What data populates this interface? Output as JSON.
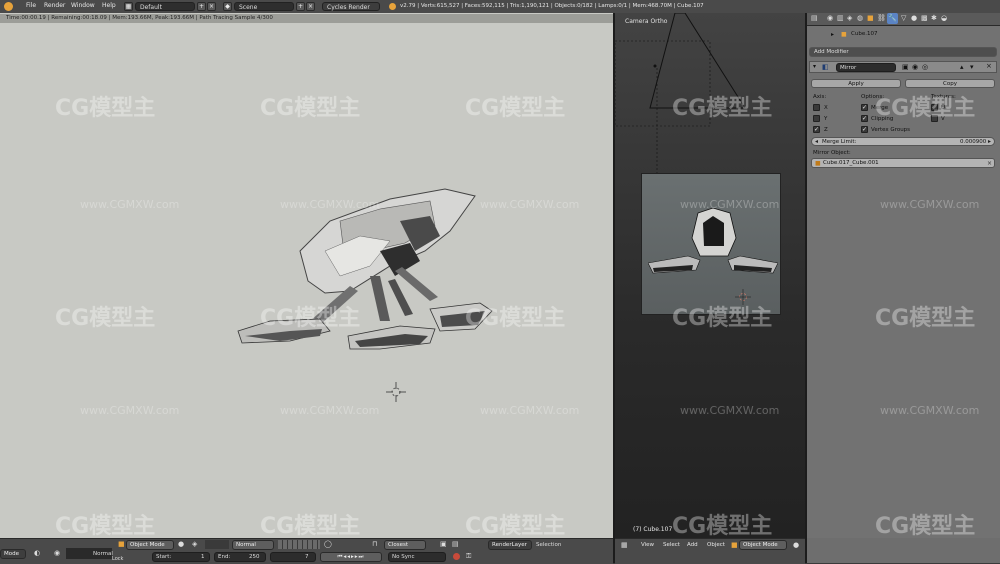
{
  "topbar": {
    "menus": [
      "File",
      "Render",
      "Window",
      "Help"
    ],
    "layout": "Default",
    "scene": "Scene",
    "engine": "Cycles Render",
    "stats": "v2.79 | Verts:615,527 | Faces:592,115 | Tris:1,190,121 | Objects:0/182 | Lamps:0/1 | Mem:468.70M | Cube.107"
  },
  "render_view": {
    "info": "Time:00:00.19 | Remaining:00:18.09 | Mem:193.66M, Peak:193.66M | Path Tracing Sample 4/300"
  },
  "camera_view": {
    "title": "Camera Ortho",
    "object_label": "(7) Cube.107"
  },
  "properties": {
    "object_name": "Cube.107",
    "add_modifier": "Add Modifier",
    "modifier_name": "Mirror",
    "apply": "Apply",
    "copy": "Copy",
    "axis_header": "Axis:",
    "options_header": "Options:",
    "textures_header": "Textures:",
    "axes": [
      {
        "label": "X",
        "checked": false
      },
      {
        "label": "Y",
        "checked": false
      },
      {
        "label": "Z",
        "checked": true
      }
    ],
    "options": [
      {
        "label": "Merge",
        "checked": true
      },
      {
        "label": "Clipping",
        "checked": true
      },
      {
        "label": "Vertex Groups",
        "checked": true
      }
    ],
    "textures": [
      {
        "label": "U",
        "checked": false
      },
      {
        "label": "V",
        "checked": false
      }
    ],
    "merge_limit_label": "Merge Limit:",
    "merge_limit_value": "0.000900",
    "mirror_object_label": "Mirror Object:",
    "mirror_object_value": "Cube.017_Cube.001"
  },
  "bottom_left": {
    "mode_fragment": "Mode",
    "object_mode": "Object Mode",
    "shading": "Normal",
    "start_label": "Start:",
    "start_value": "1",
    "end_label": "End:",
    "end_value": "250",
    "current_frame": "7",
    "interp": "Closest",
    "sync": "No Sync",
    "render_layer": "RenderLayer",
    "selection": "Selection",
    "normal_fragment": "Normal",
    "lock_fragment": "Lock"
  },
  "bottom_right": {
    "menus": [
      "View",
      "Select",
      "Add",
      "Object"
    ],
    "mode": "Object Mode"
  },
  "watermark": {
    "brand": "CG模型主",
    "url": "www.CGMXW.com"
  },
  "colors": {
    "render_bg": "#c8c9c4",
    "panel_bg": "#727272",
    "header_bg": "#4a4a4a",
    "accent_orange": "#e7a33b"
  }
}
